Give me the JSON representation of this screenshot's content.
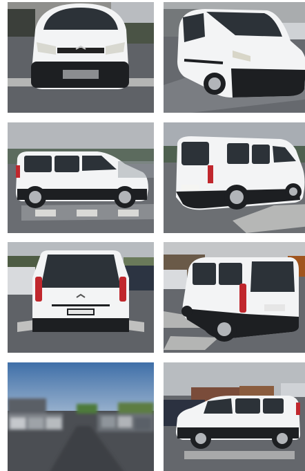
{
  "gallery": {
    "photos": [
      {
        "view": "front",
        "icon": "van-front-photo"
      },
      {
        "view": "front-three-quarter",
        "icon": "van-front-angle-photo"
      },
      {
        "view": "left-side",
        "icon": "van-side-left-photo"
      },
      {
        "view": "rear-three-quarter-left",
        "icon": "van-rear-angle-left-photo"
      },
      {
        "view": "rear",
        "icon": "van-rear-photo"
      },
      {
        "view": "rear-three-quarter-right",
        "icon": "van-rear-angle-right-photo"
      },
      {
        "view": "parking-lot-blurred",
        "icon": "parking-lot-photo"
      },
      {
        "view": "right-side-distance",
        "icon": "van-side-right-photo"
      }
    ]
  },
  "colors": {
    "sky": "#c9ccd0",
    "asphalt": "#5e6166",
    "van_body": "#f3f4f5",
    "van_trim": "#1d1f22",
    "tail_light": "#c0272d",
    "glass": "#2c3238"
  }
}
